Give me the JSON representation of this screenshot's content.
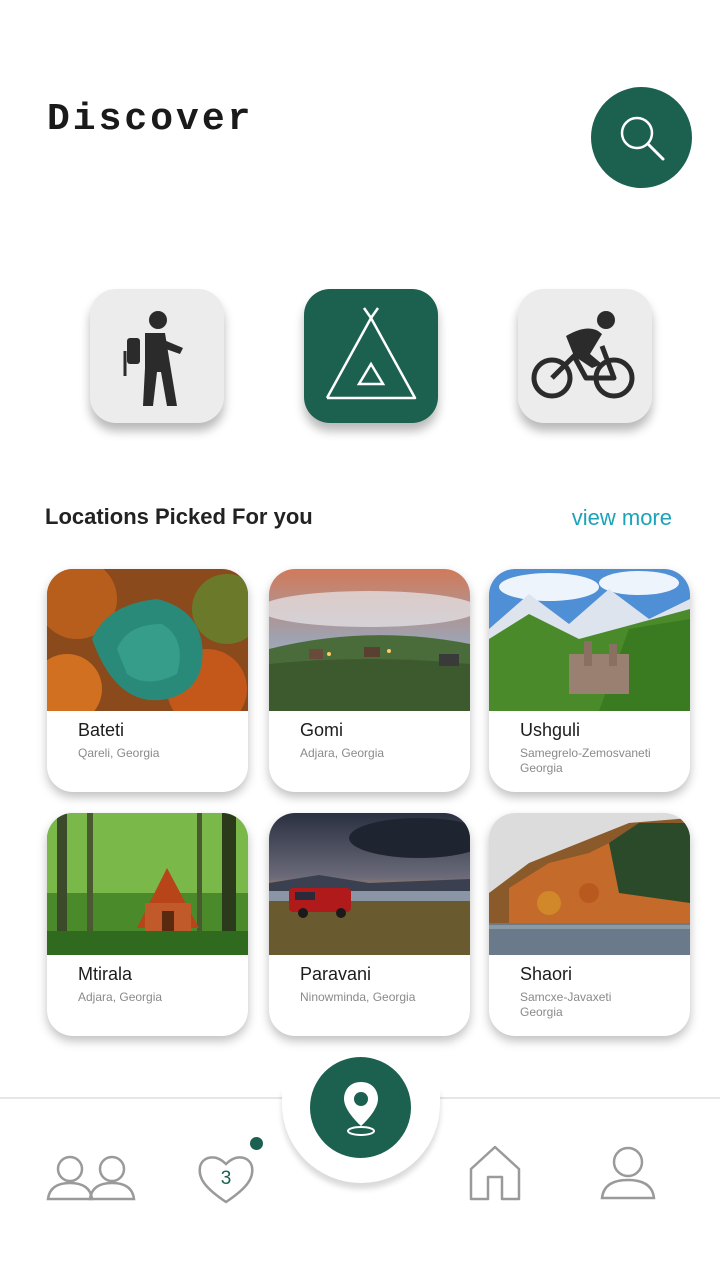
{
  "header": {
    "title": "Discover"
  },
  "categories": [
    {
      "icon": "hiker-icon",
      "active": false
    },
    {
      "icon": "tent-icon",
      "active": true
    },
    {
      "icon": "cyclist-icon",
      "active": false
    }
  ],
  "section": {
    "title": "Locations Picked For you",
    "view_more": "view more"
  },
  "locations": [
    {
      "name": "Bateti",
      "region": "Qareli, Georgia"
    },
    {
      "name": "Gomi",
      "region": "Adjara, Georgia"
    },
    {
      "name": "Ushguli",
      "region": "Samegrelo-Zemosvaneti\nGeorgia"
    },
    {
      "name": "Mtirala",
      "region": "Adjara, Georgia"
    },
    {
      "name": "Paravani",
      "region": "Ninowminda, Georgia"
    },
    {
      "name": "Shaori",
      "region": "Samcxe-Javaxeti\nGeorgia"
    }
  ],
  "nav": {
    "favorites_count": "3"
  },
  "colors": {
    "primary": "#1c6150",
    "accent": "#1aa3b9",
    "tile": "#ececec"
  }
}
